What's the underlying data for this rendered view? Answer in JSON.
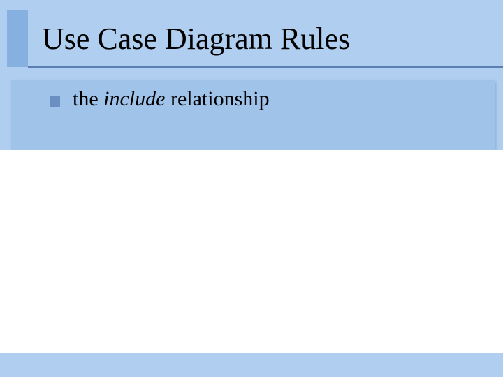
{
  "title": "Use Case Diagram Rules",
  "bullet": {
    "pre": "the ",
    "emph": "include",
    "post": " relationship"
  }
}
